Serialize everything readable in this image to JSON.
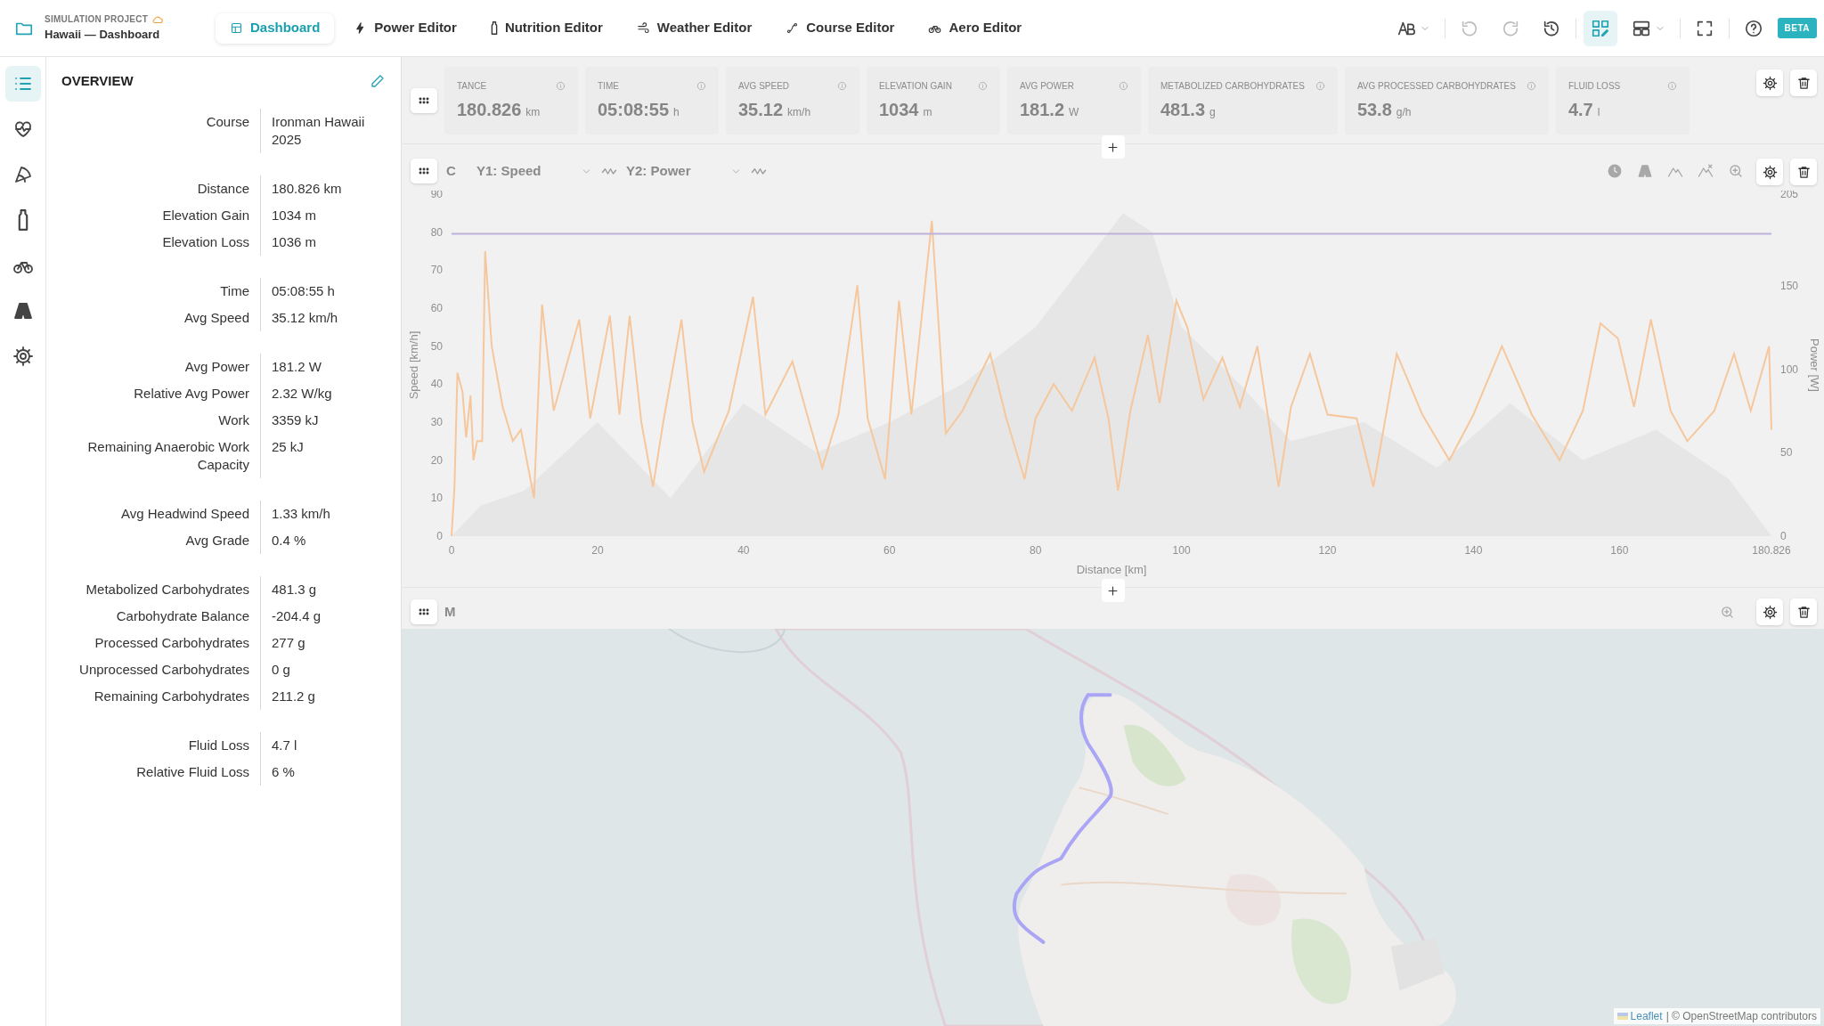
{
  "header": {
    "project_label": "SIMULATION PROJECT",
    "title": "Hawaii — Dashboard"
  },
  "tabs": [
    {
      "label": "Dashboard",
      "kind": "dashboard",
      "selected": true
    },
    {
      "label": "Power Editor",
      "kind": "bolt",
      "selected": false
    },
    {
      "label": "Nutrition Editor",
      "kind": "bottle",
      "selected": false
    },
    {
      "label": "Weather Editor",
      "kind": "wind",
      "selected": false
    },
    {
      "label": "Course Editor",
      "kind": "route",
      "selected": false
    },
    {
      "label": "Aero Editor",
      "kind": "bike",
      "selected": false
    }
  ],
  "toolbar": [
    {
      "kind": "font",
      "selected": false,
      "disabled": false
    },
    {
      "kind": "undo",
      "selected": false,
      "disabled": true
    },
    {
      "kind": "redo",
      "selected": false,
      "disabled": true
    },
    {
      "kind": "history",
      "selected": false,
      "disabled": false
    },
    {
      "kind": "edit",
      "selected": true,
      "disabled": false
    },
    {
      "kind": "layout",
      "selected": false,
      "disabled": false
    },
    {
      "kind": "fullscreen",
      "selected": false,
      "disabled": false
    },
    {
      "kind": "help",
      "selected": false,
      "disabled": false
    }
  ],
  "badge": "BETA",
  "rail": [
    {
      "kind": "list",
      "selected": true
    },
    {
      "kind": "heart",
      "selected": false
    },
    {
      "kind": "slice",
      "selected": false
    },
    {
      "kind": "bottle",
      "selected": false
    },
    {
      "kind": "bike",
      "selected": false
    },
    {
      "kind": "road",
      "selected": false
    },
    {
      "kind": "gear",
      "selected": false
    }
  ],
  "overview": {
    "title": "OVERVIEW",
    "groups": [
      [
        {
          "label": "Course",
          "value": "Ironman Hawaii 2025"
        }
      ],
      [
        {
          "label": "Distance",
          "value": "180.826 km"
        },
        {
          "label": "Elevation Gain",
          "value": "1034 m"
        },
        {
          "label": "Elevation Loss",
          "value": "1036 m"
        }
      ],
      [
        {
          "label": "Time",
          "value": "05:08:55 h"
        },
        {
          "label": "Avg Speed",
          "value": "35.12 km/h"
        }
      ],
      [
        {
          "label": "Avg Power",
          "value": "181.2 W"
        },
        {
          "label": "Relative Avg Power",
          "value": "2.32 W/kg"
        },
        {
          "label": "Work",
          "value": "3359 kJ"
        },
        {
          "label": "Remaining Anaerobic Work Capacity",
          "value": "25 kJ"
        }
      ],
      [
        {
          "label": "Avg Headwind Speed",
          "value": "1.33 km/h"
        },
        {
          "label": "Avg Grade",
          "value": "0.4 %"
        }
      ],
      [
        {
          "label": "Metabolized Carbohydrates",
          "value": "481.3 g"
        },
        {
          "label": "Carbohydrate Balance",
          "value": "-204.4 g"
        },
        {
          "label": "Processed Carbohydrates",
          "value": "277 g"
        },
        {
          "label": "Unprocessed Carbohydrates",
          "value": "0 g"
        },
        {
          "label": "Remaining Carbohydrates",
          "value": "211.2 g"
        }
      ],
      [
        {
          "label": "Fluid Loss",
          "value": "4.7 l"
        },
        {
          "label": "Relative Fluid Loss",
          "value": "6 %"
        }
      ]
    ]
  },
  "metrics": [
    {
      "label": "TANCE",
      "value": "180.826",
      "unit": "km"
    },
    {
      "label": "TIME",
      "value": "05:08:55",
      "unit": "h"
    },
    {
      "label": "AVG SPEED",
      "value": "35.12",
      "unit": "km/h"
    },
    {
      "label": "ELEVATION GAIN",
      "value": "1034",
      "unit": "m"
    },
    {
      "label": "AVG POWER",
      "value": "181.2",
      "unit": "W"
    },
    {
      "label": "METABOLIZED CARBOHYDRATES",
      "value": "481.3",
      "unit": "g"
    },
    {
      "label": "AVG PROCESSED CARBOHYDRATES",
      "value": "53.8",
      "unit": "g/h"
    },
    {
      "label": "FLUID LOSS",
      "value": "4.7",
      "unit": "l"
    }
  ],
  "chart_panel": {
    "title": "C",
    "y1": "Y1: Speed",
    "y2": "Y2: Power",
    "chart_data": {
      "type": "line",
      "xlabel": "Distance [km]",
      "ylabel": "Speed [km/h]",
      "xlim": [
        0,
        180.826
      ],
      "ylim": [
        0,
        90
      ],
      "xticks": [
        0,
        20,
        40,
        60,
        80,
        100,
        120,
        140,
        160,
        {
          "value": 180.826,
          "label": "180.826"
        }
      ],
      "yticks": [
        0,
        10,
        20,
        30,
        40,
        50,
        60,
        70,
        80,
        90
      ],
      "x": [
        0,
        0.4,
        0.8,
        1.5,
        2,
        2.6,
        3,
        3.5,
        4.2,
        4.6,
        5.5,
        7,
        8.4,
        9.5,
        11.3,
        12.4,
        14,
        17.5,
        19,
        21.7,
        23,
        24.4,
        26,
        27.6,
        29,
        31.5,
        33,
        34.6,
        38,
        41.3,
        43,
        46.7,
        49,
        50.8,
        53,
        55.6,
        57,
        59.4,
        61.3,
        63,
        65.8,
        67.7,
        70,
        73.8,
        76,
        78.5,
        80,
        82.5,
        85,
        88.1,
        90,
        91.3,
        93,
        95.4,
        97,
        99.3,
        100.8,
        103,
        105.6,
        108,
        110.4,
        113.3,
        115,
        117.6,
        120,
        124,
        126.3,
        129.5,
        133,
        136.7,
        140,
        143.9,
        148,
        151.8,
        155,
        157.4,
        159.8,
        162,
        164.3,
        167,
        169.3,
        173,
        175.7,
        178,
        180.5,
        180.826
      ],
      "series": [
        {
          "color": "#f6c79c",
          "values": [
            0,
            13,
            43,
            38,
            26,
            37,
            20,
            25,
            25,
            75,
            50,
            34,
            25,
            28,
            10,
            61,
            33,
            57,
            31,
            58,
            32,
            58,
            30,
            13,
            30,
            57,
            30,
            17,
            33,
            63,
            32,
            46,
            30,
            18,
            32,
            66,
            31,
            15,
            62,
            32,
            83,
            27,
            33,
            48,
            31,
            15,
            31,
            40,
            33,
            47,
            31,
            12,
            33,
            53,
            35,
            62,
            55,
            36,
            47,
            34,
            50,
            13,
            34,
            48,
            32,
            31,
            13,
            48,
            32,
            20,
            32,
            50,
            32,
            20,
            33,
            56,
            52,
            34,
            57,
            33,
            25,
            33,
            48,
            33,
            50,
            28
          ]
        }
      ]
    },
    "power_axis": {
      "chart_data": {
        "type": "line",
        "ylabel": "Power [W]",
        "xlim": [
          0,
          180.826
        ],
        "ylim": [
          0,
          205
        ],
        "yticks": [
          0,
          50,
          100,
          150,
          205
        ],
        "x": [
          0,
          180.826
        ],
        "series": [
          {
            "color": "#bdb2dc",
            "values": [
              181.2,
              181.2
            ]
          }
        ]
      }
    }
  },
  "map_panel": {
    "title": "M",
    "attribution_link": "Leaflet",
    "attribution": "| © OpenStreetMap contributors"
  }
}
